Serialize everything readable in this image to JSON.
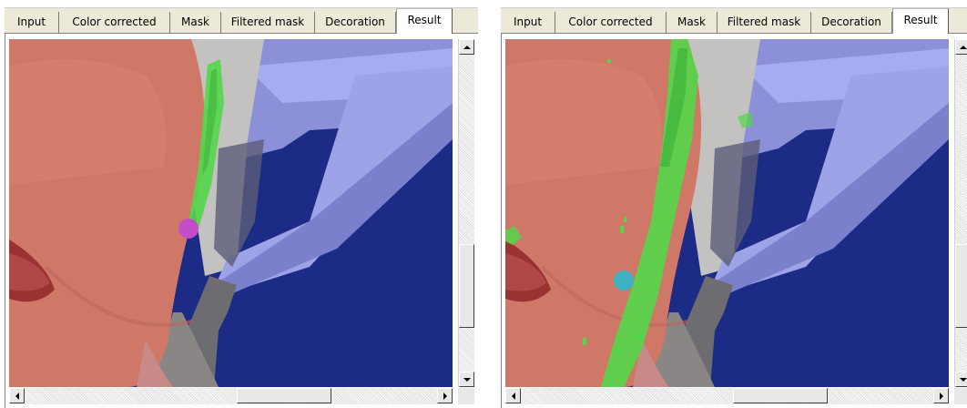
{
  "tabs": [
    "Input",
    "Color corrected",
    "Mask",
    "Filtered mask",
    "Decoration",
    "Result"
  ],
  "left_panel": {
    "active_tab": "Result",
    "marker_color": "#c34cc8",
    "stroke_color": "#54d64a"
  },
  "right_panel": {
    "active_tab": "Result",
    "marker_color": "#3fb2c2",
    "stroke_color": "#54d64a"
  },
  "colors": {
    "skin": "#d07868",
    "background_blue": "#1c2b86",
    "light_blue": "#9fa3e8",
    "lip": "#9a3232",
    "tab_bg": "#ece9d8"
  }
}
